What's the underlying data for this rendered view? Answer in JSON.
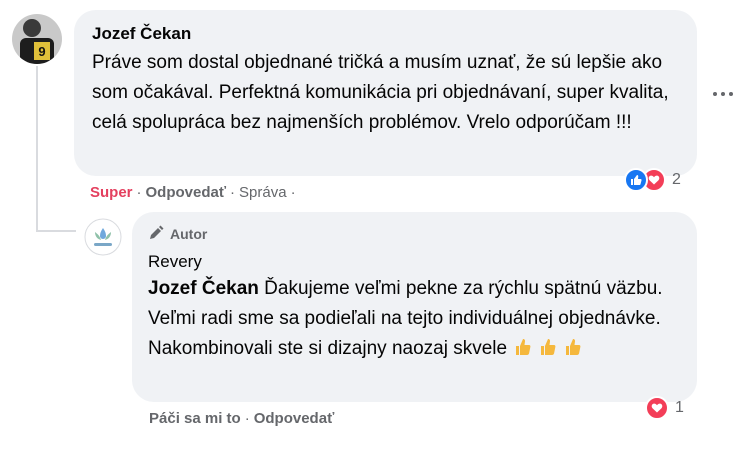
{
  "comment": {
    "author": "Jozef Čekan",
    "text": "Práve som dostal objednané tričká a musím uznať, že sú lepšie ako som očakával. Perfektná komunikácia pri objednávaní, super kvalita, celá spolupráca bez najmenších problémov. Vrelo odporúčam !!!",
    "actions": {
      "reaction": "Super",
      "reply": "Odpovedať",
      "message": "Správa",
      "separator": "·"
    },
    "reactions": {
      "icons": [
        "like-icon",
        "love-icon"
      ],
      "count": "2"
    }
  },
  "reply": {
    "badge": "Autor",
    "author": "Revery",
    "mention": "Jozef Čekan",
    "text": " Ďakujeme veľmi pekne za rýchlu spätnú väzbu. Veľmi radi sme sa podieľali na tejto individuálnej objednávke. Nakombinovali ste si dizajny naozaj skvele",
    "emoji": [
      "thumbs-up-icon",
      "thumbs-up-icon",
      "thumbs-up-icon"
    ],
    "actions": {
      "like": "Páči sa mi to",
      "reply": "Odpovedať",
      "separator": "·"
    },
    "reactions": {
      "icons": [
        "love-icon"
      ],
      "count": "1"
    }
  },
  "colors": {
    "bubble": "#f0f2f5",
    "meta": "#65676b",
    "super": "#e4405f",
    "like": "#1877f2",
    "love": "#f33e58"
  }
}
